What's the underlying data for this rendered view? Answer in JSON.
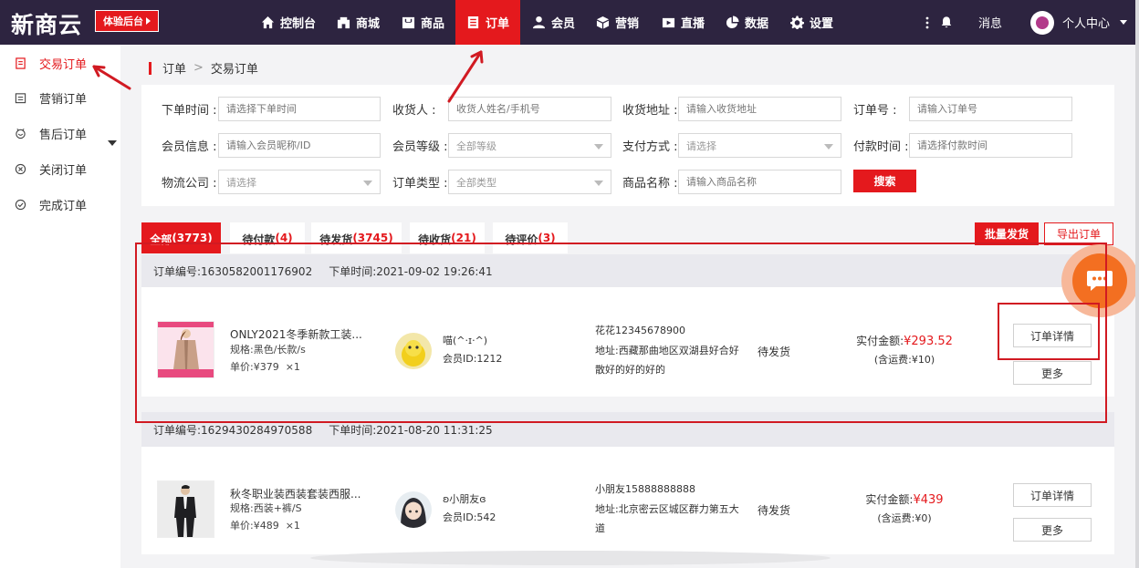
{
  "topbar": {
    "logo": "新商云",
    "trial_label": "体验后台",
    "nav": [
      {
        "label": "控制台",
        "icon": "home-icon"
      },
      {
        "label": "商城",
        "icon": "store-icon"
      },
      {
        "label": "商品",
        "icon": "product-icon"
      },
      {
        "label": "订单",
        "icon": "order-icon",
        "active": true
      },
      {
        "label": "会员",
        "icon": "member-icon"
      },
      {
        "label": "营销",
        "icon": "box-icon"
      },
      {
        "label": "直播",
        "icon": "live-icon"
      },
      {
        "label": "数据",
        "icon": "pie-chart-icon"
      },
      {
        "label": "设置",
        "icon": "gear-icon"
      }
    ],
    "messages_label": "消息",
    "user_label": "个人中心"
  },
  "sidebar": {
    "items": [
      {
        "label": "交易订单",
        "icon": "document-icon",
        "active": true
      },
      {
        "label": "营销订单",
        "icon": "list-icon"
      },
      {
        "label": "售后订单",
        "icon": "service-icon"
      },
      {
        "label": "关闭订单",
        "icon": "close-circle-icon"
      },
      {
        "label": "完成订单",
        "icon": "check-circle-icon"
      }
    ]
  },
  "breadcrumb": {
    "root": "订单",
    "separator": ">",
    "current": "交易订单"
  },
  "filters": {
    "order_time": {
      "label": "下单时间 :",
      "placeholder": "请选择下单时间"
    },
    "receiver": {
      "label": "收货人 :",
      "placeholder": "收货人姓名/手机号"
    },
    "ship_address": {
      "label": "收货地址 :",
      "placeholder": "请输入收货地址"
    },
    "order_no": {
      "label": "订单号 :",
      "placeholder": "请输入订单号"
    },
    "member_info": {
      "label": "会员信息 :",
      "placeholder": "请输入会员昵称/ID"
    },
    "member_level": {
      "label": "会员等级 :",
      "value": "全部等级"
    },
    "pay_method": {
      "label": "支付方式 :",
      "value": "请选择"
    },
    "pay_time": {
      "label": "付款时间 :",
      "placeholder": "请选择付款时间"
    },
    "logistics": {
      "label": "物流公司 :",
      "value": "请选择"
    },
    "order_type": {
      "label": "订单类型 :",
      "value": "全部类型"
    },
    "product_name": {
      "label": "商品名称 :",
      "placeholder": "请输入商品名称"
    },
    "search_label": "搜索"
  },
  "tabs": [
    {
      "label": "全部",
      "count": "(3773)",
      "active": true
    },
    {
      "label": "待付款",
      "count": "(4)"
    },
    {
      "label": "待发货",
      "count": "(3745)"
    },
    {
      "label": "待收货",
      "count": "(21)"
    },
    {
      "label": "待评价",
      "count": "(3)"
    }
  ],
  "actions": {
    "bulk_ship": "批量发货",
    "export": "导出订单"
  },
  "orders": [
    {
      "order_no": "订单编号:1630582001176902",
      "order_time": "下单时间:2021-09-02 19:26:41",
      "product_name": "ONLY2021冬季新款工装...",
      "spec": "规格:黑色/长款/s",
      "price": "单价:¥379",
      "qty": "×1",
      "member_name": "喵(^·ɪ·^)",
      "member_id": "会员ID:1212",
      "receiver": "花花12345678900",
      "address": "地址:西藏那曲地区双湖县好合好散好的好的好的",
      "status": "待发货",
      "paid_label": "实付金额:",
      "paid_amount": "¥293.52",
      "shipping": "(含运费:¥10)",
      "detail_label": "订单详情",
      "more_label": "更多"
    },
    {
      "order_no": "订单编号:1629430284970588",
      "order_time": "下单时间:2021-08-20 11:31:25",
      "product_name": "秋冬职业装西装套装西服...",
      "spec": "规格:西装+裤/S",
      "price": "单价:¥489",
      "qty": "×1",
      "member_name": "ʚ小朋友ɞ",
      "member_id": "会员ID:542",
      "receiver": "小朋友15888888888",
      "address": "地址:北京密云区城区群力第五大道",
      "status": "待发货",
      "paid_label": "实付金额:",
      "paid_amount": "¥439",
      "shipping": "(含运费:¥0)",
      "detail_label": "订单详情",
      "more_label": "更多"
    }
  ],
  "colors": {
    "accent": "#e4191d",
    "topbar": "#2d2440",
    "annotation": "#d11a22"
  }
}
